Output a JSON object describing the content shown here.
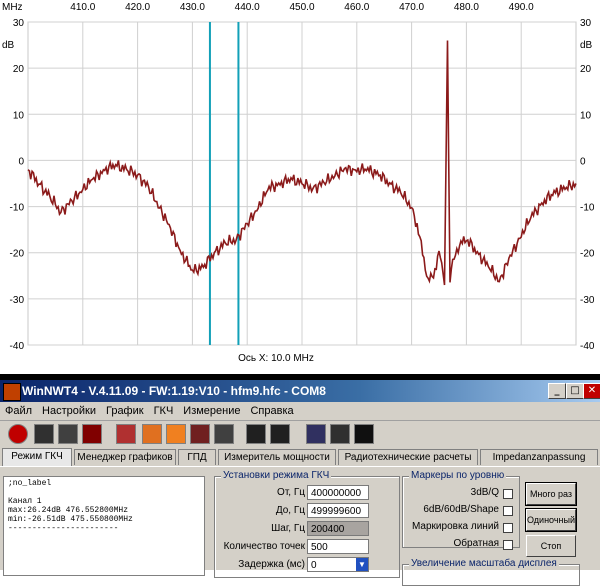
{
  "plot": {
    "x_unit": "MHz",
    "y_unit": "dB",
    "x_ticks": [
      "410.0",
      "420.0",
      "430.0",
      "440.0",
      "450.0",
      "460.0",
      "470.0",
      "480.0",
      "490.0"
    ],
    "y_ticks": [
      "30",
      "20",
      "10",
      "0",
      "-10",
      "-20",
      "-30",
      "-40"
    ],
    "x_axis_label": "Ось X: 10.0 MHz",
    "trace_color": "#8b1a1a",
    "cursor_color": "#12a0b8",
    "cursors_mhz": [
      433.2,
      438.4
    ]
  },
  "chart_data": {
    "type": "line",
    "title": "",
    "xlabel": "Ось X: 10.0 MHz",
    "ylabel": "dB",
    "xlim": [
      400,
      500
    ],
    "ylim": [
      -40,
      30
    ],
    "x_ticks": [
      410,
      420,
      430,
      440,
      450,
      460,
      470,
      480,
      490
    ],
    "y_ticks": [
      30,
      20,
      10,
      0,
      -10,
      -20,
      -30,
      -40
    ],
    "grid": true,
    "series": [
      {
        "x": [
          400,
          402,
          404,
          406,
          408,
          410,
          412,
          414,
          416,
          418,
          420,
          422,
          424,
          426,
          428,
          430,
          432,
          434,
          436,
          438,
          440,
          442,
          444,
          446,
          448,
          450,
          452,
          454,
          456,
          458,
          460,
          462,
          464,
          466,
          468,
          470,
          471,
          472,
          473,
          474,
          475,
          475.5,
          476,
          476.55,
          477,
          477.5,
          478,
          479,
          480,
          482,
          484,
          486,
          488,
          490,
          492,
          494,
          496,
          498,
          500
        ],
        "y": [
          -2,
          -5,
          -8,
          -11,
          -9,
          -6,
          -4,
          -2,
          -1,
          -2,
          -3,
          -6,
          -10,
          -15,
          -20,
          -24,
          -23,
          -20,
          -18,
          -17,
          -14,
          -10,
          -6,
          -5,
          -4,
          -5,
          -6,
          -5,
          -3,
          -2,
          -2,
          -2,
          -3,
          -5,
          -7,
          -10,
          -14,
          -20,
          -26,
          -25,
          -20,
          -22,
          -27,
          26,
          -26,
          -22,
          -20,
          -18,
          -17,
          -20,
          -23,
          -26,
          -21,
          -16,
          -12,
          -9,
          -7,
          -6,
          -5
        ]
      }
    ]
  },
  "window": {
    "title": "WinNWT4 - V.4.11.09 - FW:1.19:V10 - hfm9.hfc - COM8",
    "minimize": "_",
    "maximize": "□",
    "close": "✕"
  },
  "menu": [
    "Файл",
    "Настройки",
    "График",
    "ГКЧ",
    "Измерение",
    "Справка"
  ],
  "tabs": [
    "Режим ГКЧ",
    "Менеджер графиков",
    "ГПД",
    "Измеритель мощности",
    "Радиотехнические расчеты",
    "Impedanzanpassung"
  ],
  "info": {
    "lines": [
      ";no_label",
      "",
      "Канал 1",
      "max:26.24dB 476.552800MHz",
      "min:-26.51dB 475.550800MHz",
      "-----------------------"
    ]
  },
  "sweep": {
    "group_title": "Установки режима ГКЧ",
    "from_label": "От, Гц",
    "from_value": "400000000",
    "to_label": "До, Гц",
    "to_value": "499999600",
    "step_label": "Шаг, Гц",
    "step_value": "200400",
    "points_label": "Количество точек",
    "points_value": "500",
    "delay_label": "Задержка (мс)",
    "delay_value": "0"
  },
  "markers": {
    "group_title": "Маркеры по уровню",
    "items": [
      "3dB/Q",
      "6dB/60dB/Shape",
      "Маркировка линий",
      "Обратная"
    ]
  },
  "zoom": {
    "group_title": "Увеличение масштаба дисплея"
  },
  "buttons": {
    "multi": "Много раз",
    "single": "Одиночный",
    "stop": "Стоп"
  },
  "colors": {
    "titlebar": "#0a246a",
    "face": "#d4d0c8"
  }
}
